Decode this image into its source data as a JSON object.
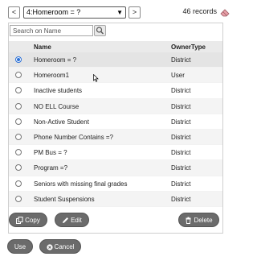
{
  "nav": {
    "prev_label": "<",
    "next_label": ">",
    "selected_filter": "4:Homeroom = ?",
    "records_label": "46 records",
    "clear_icon": "eraser-icon"
  },
  "search": {
    "placeholder": "Search on Name",
    "icon": "search-icon"
  },
  "table": {
    "columns": {
      "name": "Name",
      "owner": "OwnerType"
    },
    "rows": [
      {
        "name": "Homeroom = ?",
        "owner": "District",
        "selected": true
      },
      {
        "name": "Homeroom1",
        "owner": "User",
        "selected": false
      },
      {
        "name": "Inactive students",
        "owner": "District",
        "selected": false
      },
      {
        "name": "NO ELL Course",
        "owner": "District",
        "selected": false
      },
      {
        "name": "Non-Active Student",
        "owner": "District",
        "selected": false
      },
      {
        "name": "Phone Number Contains =?",
        "owner": "District",
        "selected": false
      },
      {
        "name": "PM Bus = ?",
        "owner": "District",
        "selected": false
      },
      {
        "name": "Program =?",
        "owner": "District",
        "selected": false
      },
      {
        "name": "Seniors with missing final grades",
        "owner": "District",
        "selected": false
      },
      {
        "name": "Student Suspensions",
        "owner": "District",
        "selected": false
      }
    ]
  },
  "actions": {
    "copy": "Copy",
    "edit": "Edit",
    "delete": "Delete"
  },
  "footer": {
    "use": "Use",
    "cancel": "Cancel"
  },
  "colors": {
    "accent": "#2a6fd6",
    "button": "#6b6b6b",
    "header_bg": "#eaeaea"
  }
}
